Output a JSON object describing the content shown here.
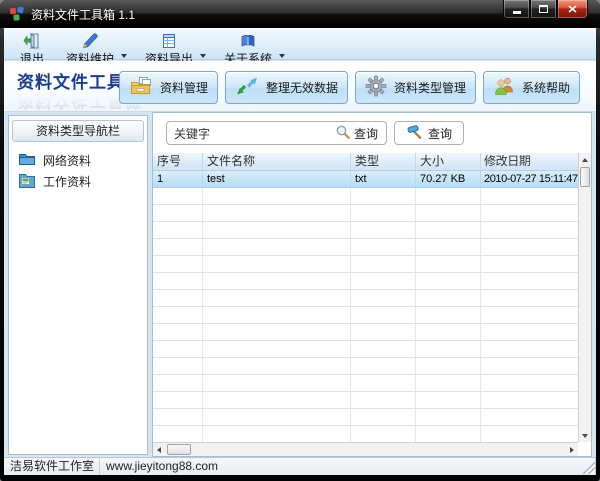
{
  "window": {
    "title": "资料文件工具箱 1.1"
  },
  "toolbar": {
    "items": [
      {
        "label": "退出",
        "icon": "exit-icon",
        "has_dropdown": false
      },
      {
        "label": "资料维护",
        "icon": "pen-icon",
        "has_dropdown": true
      },
      {
        "label": "资料导出",
        "icon": "export-icon",
        "has_dropdown": true
      },
      {
        "label": "关于系统",
        "icon": "book-icon",
        "has_dropdown": true
      }
    ]
  },
  "header": {
    "title": "资料文件工具箱",
    "buttons": [
      {
        "label": "资料管理",
        "icon": "folder-icon"
      },
      {
        "label": "整理无效数据",
        "icon": "clean-arrows-icon"
      },
      {
        "label": "资料类型管理",
        "icon": "gear-icon"
      },
      {
        "label": "系统帮助",
        "icon": "help-people-icon"
      }
    ]
  },
  "sidebar": {
    "title": "资料类型导航栏",
    "items": [
      {
        "label": "网络资料",
        "icon": "folder-blue-icon"
      },
      {
        "label": "工作资料",
        "icon": "folder-work-icon"
      }
    ]
  },
  "search": {
    "keyword": "关键字",
    "search_label": "查询",
    "query_label": "查询"
  },
  "table": {
    "columns": [
      "序号",
      "文件名称",
      "类型",
      "大小",
      "修改日期"
    ],
    "rows": [
      [
        "1",
        "test",
        "txt",
        "70.27 KB",
        "2010-07-27 15:11:47"
      ]
    ],
    "selected_row_index": 0,
    "empty_row_count": 15
  },
  "statusbar": {
    "left": "洁易软件工作室",
    "right": "www.jieyitong88.com"
  },
  "colors": {
    "titlebar": "#1b1b1b",
    "close_button": "#a62612",
    "accent_border": "#74a9d1",
    "selected_row": "#b4dcf5",
    "header_title_text": "#1c3a8e",
    "toolbar_gradient_top": "#f3f9fe",
    "toolbar_gradient_bottom": "#cfe4f5"
  }
}
